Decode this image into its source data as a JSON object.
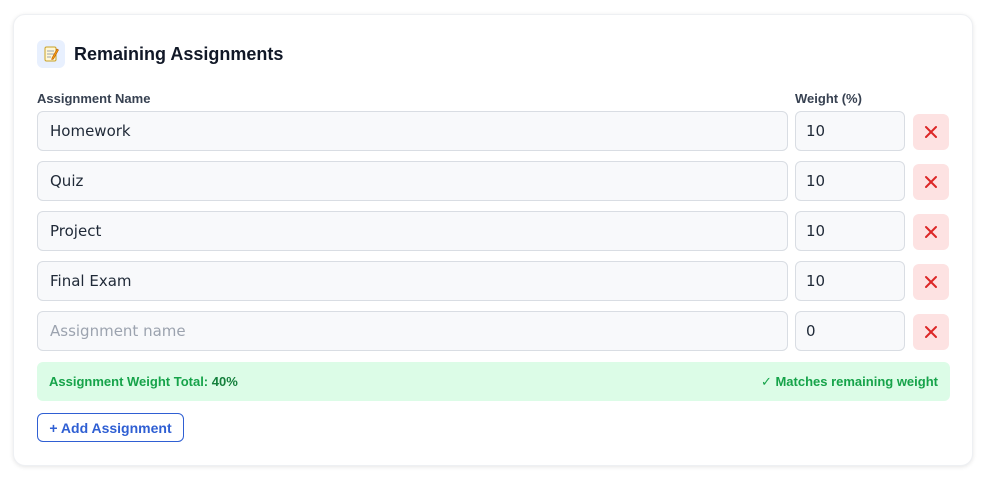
{
  "section": {
    "icon": "memo-icon",
    "title": "Remaining Assignments"
  },
  "columns": {
    "name_label": "Assignment Name",
    "weight_label": "Weight (%)"
  },
  "assignments": [
    {
      "name": "Homework",
      "weight": "10"
    },
    {
      "name": "Quiz",
      "weight": "10"
    },
    {
      "name": "Project",
      "weight": "10"
    },
    {
      "name": "Final Exam",
      "weight": "10"
    },
    {
      "name": "",
      "name_placeholder": "Assignment name",
      "weight": "0"
    }
  ],
  "delete_icon": "close-icon",
  "summary": {
    "total_label": "Assignment Weight Total:",
    "total_value": "40%",
    "status_text": "✓ Matches remaining weight"
  },
  "add_button_label": "+ Add Assignment",
  "colors": {
    "accent": "#2f5fd3",
    "success_text": "#16a34a",
    "success_bg": "#dcfce7",
    "danger": "#dc2626",
    "danger_bg": "#fde2e2"
  }
}
